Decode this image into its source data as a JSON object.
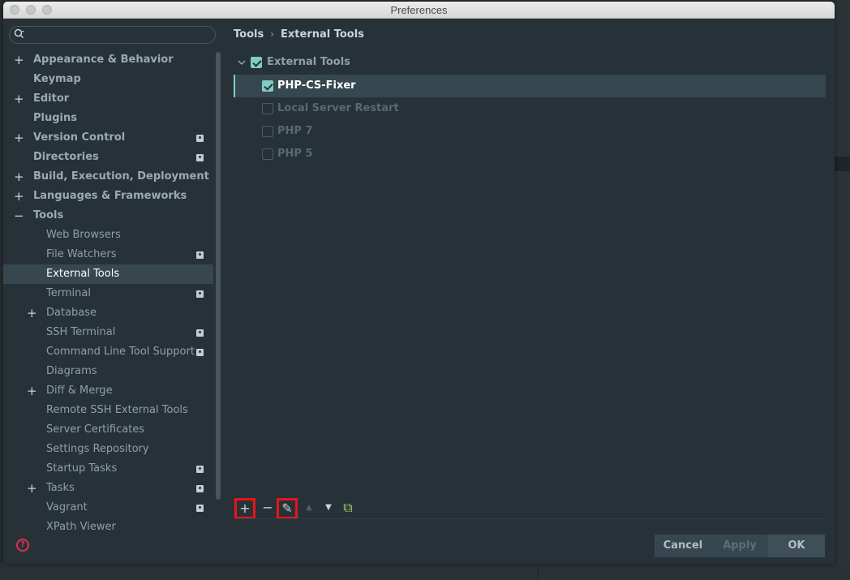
{
  "window": {
    "title": "Preferences"
  },
  "search": {
    "placeholder": "",
    "value": ""
  },
  "tree": {
    "items": [
      {
        "label": "Appearance & Behavior",
        "level": 0,
        "expander": "+",
        "project": false
      },
      {
        "label": "Keymap",
        "level": 0,
        "expander": "",
        "project": false
      },
      {
        "label": "Editor",
        "level": 0,
        "expander": "+",
        "project": false
      },
      {
        "label": "Plugins",
        "level": 0,
        "expander": "",
        "project": false
      },
      {
        "label": "Version Control",
        "level": 0,
        "expander": "+",
        "project": true
      },
      {
        "label": "Directories",
        "level": 0,
        "expander": "",
        "project": true
      },
      {
        "label": "Build, Execution, Deployment",
        "level": 0,
        "expander": "+",
        "project": false
      },
      {
        "label": "Languages & Frameworks",
        "level": 0,
        "expander": "+",
        "project": false
      },
      {
        "label": "Tools",
        "level": 0,
        "expander": "−",
        "project": false
      },
      {
        "label": "Web Browsers",
        "level": 1,
        "expander": "",
        "project": false
      },
      {
        "label": "File Watchers",
        "level": 1,
        "expander": "",
        "project": true
      },
      {
        "label": "External Tools",
        "level": 1,
        "expander": "",
        "project": false,
        "selected": true
      },
      {
        "label": "Terminal",
        "level": 1,
        "expander": "",
        "project": true
      },
      {
        "label": "Database",
        "level": 1,
        "expander": "+",
        "project": false
      },
      {
        "label": "SSH Terminal",
        "level": 1,
        "expander": "",
        "project": true
      },
      {
        "label": "Command Line Tool Support",
        "level": 1,
        "expander": "",
        "project": true
      },
      {
        "label": "Diagrams",
        "level": 1,
        "expander": "",
        "project": false
      },
      {
        "label": "Diff & Merge",
        "level": 1,
        "expander": "+",
        "project": false
      },
      {
        "label": "Remote SSH External Tools",
        "level": 1,
        "expander": "",
        "project": false
      },
      {
        "label": "Server Certificates",
        "level": 1,
        "expander": "",
        "project": false
      },
      {
        "label": "Settings Repository",
        "level": 1,
        "expander": "",
        "project": false
      },
      {
        "label": "Startup Tasks",
        "level": 1,
        "expander": "",
        "project": true
      },
      {
        "label": "Tasks",
        "level": 1,
        "expander": "+",
        "project": true
      },
      {
        "label": "Vagrant",
        "level": 1,
        "expander": "",
        "project": true
      },
      {
        "label": "XPath Viewer",
        "level": 1,
        "expander": "",
        "project": false
      }
    ]
  },
  "breadcrumb": {
    "parent": "Tools",
    "separator": "›",
    "current": "External Tools"
  },
  "content": {
    "group": {
      "label": "External Tools",
      "checked": true
    },
    "tools": [
      {
        "label": "PHP-CS-Fixer",
        "checked": true,
        "selected": true
      },
      {
        "label": "Local Server Restart",
        "checked": false,
        "selected": false
      },
      {
        "label": "PHP 7",
        "checked": false,
        "selected": false
      },
      {
        "label": "PHP 5",
        "checked": false,
        "selected": false
      }
    ]
  },
  "toolbar": {
    "add": "+",
    "remove": "−",
    "edit": "✎",
    "up": "▲",
    "down": "▼",
    "copy": "⧉"
  },
  "footer": {
    "help": "?",
    "cancel_label": "Cancel",
    "apply_label": "Apply",
    "ok_label": "OK"
  },
  "colors": {
    "accent": "#80cbc4",
    "highlight_frame": "#e8141b",
    "help": "#e0304e"
  }
}
